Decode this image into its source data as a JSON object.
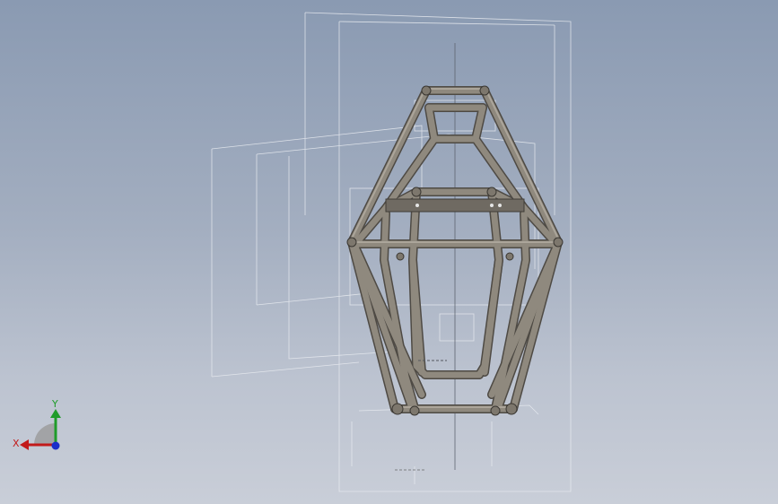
{
  "viewport": {
    "background_top": "#8a9ab2",
    "background_bottom": "#c9ced8",
    "tube_color": "#8f897e",
    "tube_shadow": "#4e4a44",
    "sketch_line_color": "#e9ecf1"
  },
  "triad": {
    "x_label": "X",
    "y_label": "Y",
    "x_color": "#c21a1a",
    "y_color": "#1f9c2a",
    "z_color": "#1c2fc9"
  }
}
